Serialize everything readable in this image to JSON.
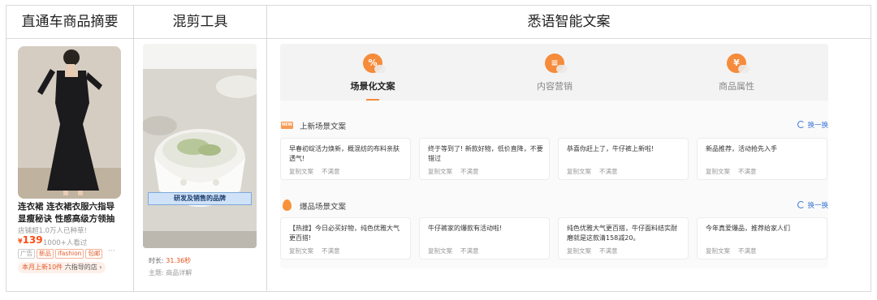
{
  "columns": {
    "product_summary": "直通车商品摘要",
    "clip_tool": "混剪工具",
    "ai_copy": "悉语智能文案"
  },
  "product": {
    "title": "连衣裙 连衣裙衣服六指导显瘦秘诀 性感高级方领抽",
    "sales_note": "店铺超1.0万人已种草!",
    "price_symbol": "¥",
    "price": "139",
    "buyers": "1000+人看过",
    "tags": [
      "广告",
      "新品",
      "ifashion",
      "包邮"
    ],
    "more": "···",
    "promo_highlight": "本月上新10件",
    "promo_rest": "六指导的店",
    "promo_arrow": "›"
  },
  "video": {
    "caption": "研发及销售的品牌",
    "duration_label": "时长:",
    "duration_value": "31.36秒",
    "subject_label": "主题:",
    "subject_value": "商品详解"
  },
  "copy_tool": {
    "tabs": [
      {
        "label": "场景化文案",
        "icon": "tag-icon",
        "glyph": "%",
        "active": true
      },
      {
        "label": "内容营销",
        "icon": "document-icon",
        "glyph": "≡",
        "active": false
      },
      {
        "label": "商品属性",
        "icon": "yen-icon",
        "glyph": "¥",
        "active": false
      }
    ],
    "sections": [
      {
        "badge": "NEW",
        "title": "上新场景文案",
        "refresh_label": "换一换",
        "cards": [
          "早春初绽活力焕新，概混纺的布料亲肤透气!",
          "终于等到了! 新款好物，低价直降，不要错过",
          "恭喜你赶上了，牛仔裤上新啦!",
          "新品推荐，活动抢先入手"
        ]
      },
      {
        "title": "爆品场景文案",
        "refresh_label": "换一换",
        "cards": [
          "【热搜】今日必买好物，纯色优雅大气更百搭!",
          "牛仔裤家的爆款有活动啦!",
          "纯色优雅大气更百搭，牛仔面料结实耐磨就是这款清158减20。",
          "今年真爱爆品，推荐给家人们"
        ]
      }
    ],
    "card_actions": {
      "copy": "复制文案",
      "dislike": "不满意"
    }
  }
}
